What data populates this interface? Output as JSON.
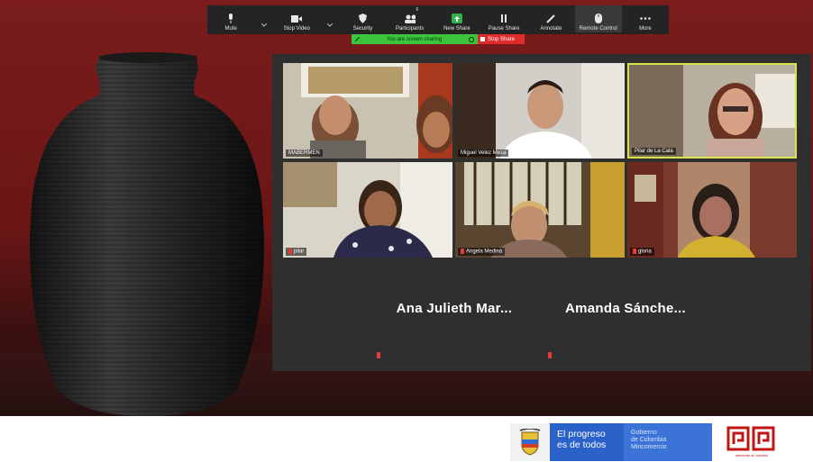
{
  "toolbar": {
    "items": [
      {
        "label": "Mute",
        "icon": "microphone-icon"
      },
      {
        "label": "",
        "icon": "chevron-up-icon"
      },
      {
        "label": "Stop Video",
        "icon": "video-camera-icon"
      },
      {
        "label": "",
        "icon": "chevron-up-icon"
      },
      {
        "label": "Security",
        "icon": "shield-icon"
      },
      {
        "label": "Participants",
        "icon": "participants-icon",
        "count": "6"
      },
      {
        "label": "New Share",
        "icon": "share-screen-icon"
      },
      {
        "label": "Pause Share",
        "icon": "pause-icon"
      },
      {
        "label": "Annotate",
        "icon": "pencil-icon"
      },
      {
        "label": "Remote Control",
        "icon": "mouse-icon"
      },
      {
        "label": "More",
        "icon": "more-dots-icon"
      }
    ]
  },
  "sharebar": {
    "status": "You are screen sharing",
    "stop_label": "Stop Share"
  },
  "participants": [
    {
      "name": "MABERMEN"
    },
    {
      "name": "Miguel Velez Meza"
    },
    {
      "name": "Pilar de La Cala"
    },
    {
      "name": "pilar"
    },
    {
      "name": "Angela Medina"
    },
    {
      "name": "gloria"
    }
  ],
  "no_video_tiles": [
    {
      "name": "Ana Julieth Mar..."
    },
    {
      "name": "Amanda Sánche..."
    }
  ],
  "footer": {
    "slogan_line1": "El progreso",
    "slogan_line2": "es de todos",
    "ministry_line1": "Gobierno",
    "ministry_line2": "de Colombia",
    "ministry_line3": "Mincomercio",
    "logo_caption": "artesanías de colombia"
  },
  "colors": {
    "toolbar_bg": "#242424",
    "share_green": "#3cc43c",
    "stop_red": "#e02c2c",
    "speaker_highlight": "#d6e64a",
    "gov_blue": "#2a62c9"
  }
}
